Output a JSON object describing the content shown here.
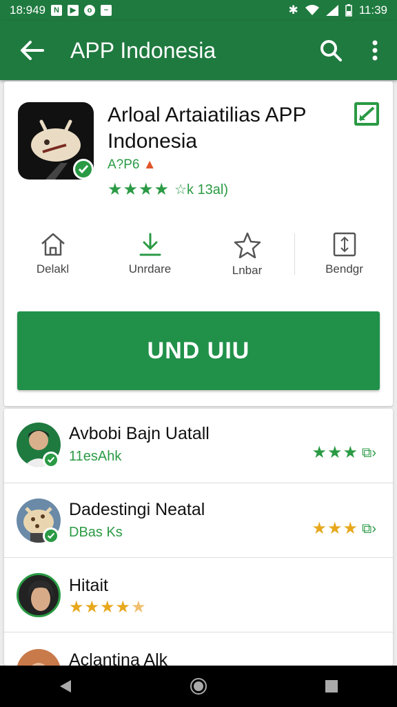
{
  "status_bar": {
    "time_left": "18:949",
    "time_right": "11:39"
  },
  "app_bar": {
    "title": "APP Indonesia"
  },
  "app": {
    "title": "Arloal Artaiatilias APP Indonesia",
    "developer": "A?P6",
    "rating_text": "☆k 13al)",
    "rating_stars": 4
  },
  "actions": [
    {
      "label": "Delakl",
      "icon": "home-icon"
    },
    {
      "label": "Unrdare",
      "icon": "download-icon"
    },
    {
      "label": "Lnbar",
      "icon": "star-outline-icon"
    },
    {
      "label": "Bendgr",
      "icon": "share-box-icon"
    }
  ],
  "install_button": {
    "label": "UND UIU"
  },
  "reviews": [
    {
      "name": "Avbobi Bajn Uatall",
      "sub": "11esAhk",
      "stars": 3,
      "star_color": "#2a9a44"
    },
    {
      "name": "Dadestingi Neatal",
      "sub": "DBas Ks",
      "stars": 3,
      "star_color": "#e7a81d"
    },
    {
      "name": "Hitait",
      "sub": "",
      "stars": 5,
      "star_color": "#e7a81d"
    },
    {
      "name": "Aclantina Alk",
      "sub": "",
      "stars": 0,
      "star_color": "#e7a81d"
    }
  ],
  "colors": {
    "primary": "#1f7a3f",
    "accent": "#2a9a44",
    "install": "#21914a",
    "gold": "#e7a81d"
  }
}
